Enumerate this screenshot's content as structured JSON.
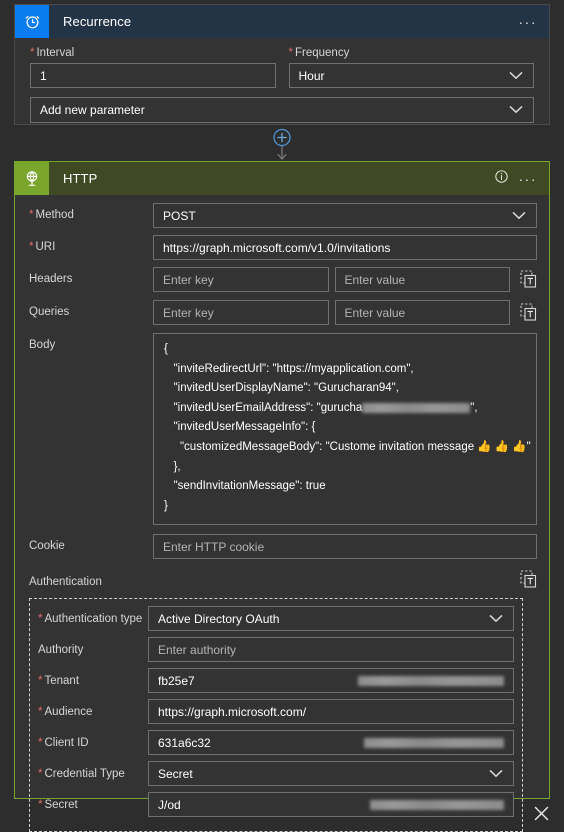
{
  "recurrence": {
    "title": "Recurrence",
    "icon": "alarm-clock-icon",
    "header_color": "#243447",
    "icon_bg": "#0a7cf0",
    "more_label": "···",
    "interval": {
      "label": "Interval",
      "required": true,
      "value": "1"
    },
    "frequency": {
      "label": "Frequency",
      "required": true,
      "value": "Hour"
    },
    "add_parameter": {
      "label": "Add new parameter"
    }
  },
  "connector": {
    "add_label": "+",
    "name": "add-action-button"
  },
  "http": {
    "title": "HTTP",
    "icon": "globe-icon",
    "header_color": "#3f4a24",
    "icon_bg": "#7ba62e",
    "border_color": "#77a52b",
    "info_label": "i",
    "more_label": "···",
    "method": {
      "label": "Method",
      "required": true,
      "value": "POST"
    },
    "uri": {
      "label": "URI",
      "required": true,
      "value": "https://graph.microsoft.com/v1.0/invitations"
    },
    "headers": {
      "label": "Headers",
      "key_placeholder": "Enter key",
      "value_placeholder": "Enter value",
      "key_value": "",
      "value_value": ""
    },
    "queries": {
      "label": "Queries",
      "key_placeholder": "Enter key",
      "value_placeholder": "Enter value",
      "key_value": "",
      "value_value": ""
    },
    "body": {
      "label": "Body",
      "lines": [
        "{",
        "   \"inviteRedirectUrl\": \"https://myapplication.com\",",
        "   \"invitedUserDisplayName\": \"Gurucharan94\",",
        "   \"invitedUserMessageInfo\": {",
        "     \"customizedMessageBody\": \"Custome invitation message 👍 👍 👍\"",
        "   },",
        "   \"sendInvitationMessage\": true",
        "}"
      ],
      "email_line_prefix": "   \"invitedUserEmailAddress\": \"gurucha",
      "email_line_suffix": "\","
    },
    "cookie": {
      "label": "Cookie",
      "placeholder": "Enter HTTP cookie",
      "value": ""
    },
    "authentication": {
      "label": "Authentication",
      "type": {
        "label": "Authentication type",
        "required": true,
        "value": "Active Directory OAuth"
      },
      "authority": {
        "label": "Authority",
        "required": false,
        "placeholder": "Enter authority",
        "value": ""
      },
      "tenant": {
        "label": "Tenant",
        "required": true,
        "value": "fb25e7"
      },
      "audience": {
        "label": "Audience",
        "required": true,
        "value": "https://graph.microsoft.com/"
      },
      "client_id": {
        "label": "Client ID",
        "required": true,
        "value": "631a6c32"
      },
      "credential_type": {
        "label": "Credential Type",
        "required": true,
        "value": "Secret"
      },
      "secret": {
        "label": "Secret",
        "required": true,
        "value": "J/od"
      },
      "close_label": "✕"
    }
  }
}
